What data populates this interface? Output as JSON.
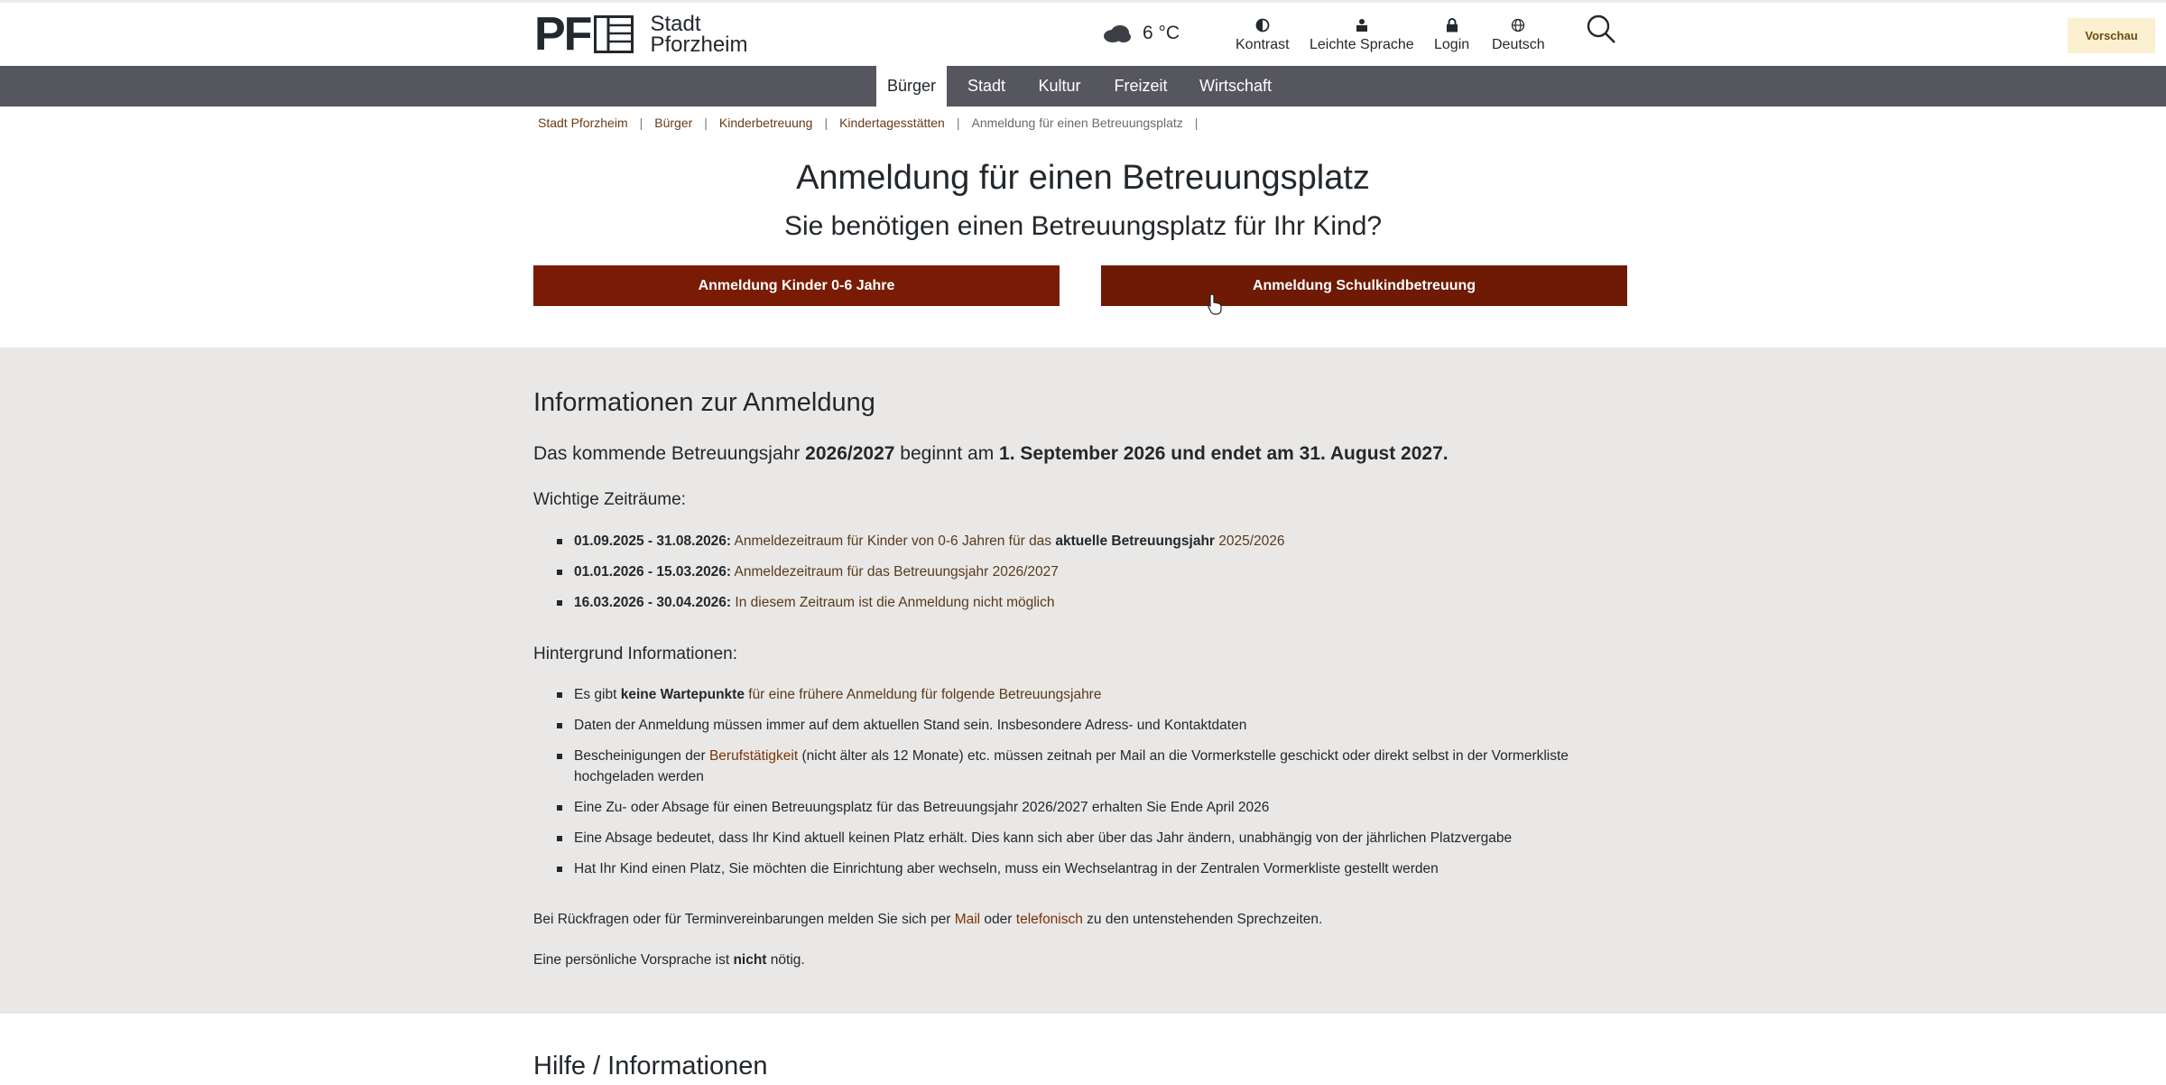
{
  "header": {
    "logo_letters": "PF",
    "logo_line1": "Stadt",
    "logo_line2": "Pforzheim",
    "weather_icon": "cloud-icon",
    "temperature": "6 °C",
    "utilities": [
      {
        "label": "Kontrast",
        "icon": "contrast-icon"
      },
      {
        "label": "Leichte Sprache",
        "icon": "easy-language-icon"
      },
      {
        "label": "Login",
        "icon": "lock-icon"
      },
      {
        "label": "Deutsch",
        "icon": "globe-icon"
      }
    ],
    "search_icon": "search-icon",
    "preview_label": "Vorschau"
  },
  "nav": {
    "items": [
      {
        "label": "Bürger",
        "active": true
      },
      {
        "label": "Stadt"
      },
      {
        "label": "Kultur"
      },
      {
        "label": "Freizeit"
      },
      {
        "label": "Wirtschaft"
      }
    ]
  },
  "breadcrumb": {
    "items": [
      "Stadt Pforzheim",
      "Bürger",
      "Kinderbetreuung",
      "Kindertagesstätten"
    ],
    "current": "Anmeldung für einen Betreuungsplatz"
  },
  "page": {
    "title": "Anmeldung für einen Betreuungsplatz",
    "subtitle": "Sie benötigen einen Betreuungsplatz für Ihr Kind?",
    "button1": "Anmeldung Kinder 0-6 Jahre",
    "button2": "Anmeldung Schulkindbetreuung"
  },
  "info": {
    "heading": "Informationen zur Anmeldung",
    "lead": {
      "p1": "Das kommende Betreuungsjahr ",
      "b1": "2026/2027",
      "p2": " beginnt am ",
      "b2": "1. September 2026 und endet am 31. August 2027."
    },
    "periods_heading": "Wichtige Zeiträume:",
    "periods": [
      {
        "date": "01.09.2025 - 31.08.2026:",
        "text": " Anmeldezeitraum für Kinder von 0-6 Jahren für das ",
        "bold": "aktuelle Betreuungsjahr",
        "tail": " 2025/2026"
      },
      {
        "date": "01.01.2026 - 15.03.2026:",
        "text": " Anmeldezeitraum für das Betreuungsjahr 2026/2027"
      },
      {
        "date": "16.03.2026 - 30.04.2026:",
        "text": " In diesem Zeitraum ist die Anmeldung nicht möglich"
      }
    ],
    "background_heading": "Hintergrund Informationen:",
    "background": {
      "b1_pre": "Es gibt ",
      "b1_bold": "keine Wartepunkte",
      "b1_post": " für eine frühere Anmeldung für folgende Betreuungsjahre",
      "b2": "Daten der Anmeldung müssen immer auf dem aktuellen Stand sein. Insbesondere Adress- und Kontaktdaten",
      "b3_pre": "Bescheinigungen der ",
      "b3_link": "Berufstätigkeit",
      "b3_post": " (nicht älter als 12 Monate) etc. müssen zeitnah per Mail an die Vormerkstelle geschickt oder direkt selbst in der Vormerkliste hochgeladen werden",
      "b4": "Eine Zu- oder Absage für einen Betreuungsplatz für das Betreuungsjahr 2026/2027 erhalten Sie Ende April 2026",
      "b5": "Eine Absage bedeutet, dass Ihr Kind aktuell keinen Platz erhält. Dies kann sich aber über das Jahr ändern, unabhängig von der jährlichen Platzvergabe",
      "b6": "Hat Ihr Kind einen Platz, Sie möchten die Einrichtung aber wechseln, muss ein Wechselantrag in der Zentralen Vormerkliste gestellt werden"
    },
    "contact": {
      "pre": "Bei Rückfragen oder für Terminvereinbarungen melden Sie sich per ",
      "mail": "Mail",
      "mid": " oder ",
      "phone": "telefonisch",
      "post": " zu den untenstehenden Sprechzeiten."
    },
    "personal": {
      "pre": "Eine persönliche Vorsprache ist ",
      "bold": "nicht",
      "post": " nötig."
    }
  },
  "help_heading": "Hilfe / Informationen"
}
